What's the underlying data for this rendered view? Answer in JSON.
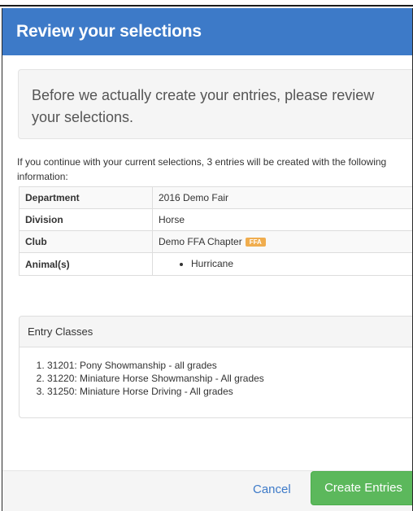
{
  "modal": {
    "title": "Review your selections",
    "lead": "Before we actually create your entries, please review your selections.",
    "info": "If you continue with your current selections, 3 entries will be created with the following information:"
  },
  "details": {
    "department_label": "Department",
    "department_value": "2016 Demo Fair",
    "division_label": "Division",
    "division_value": "Horse",
    "club_label": "Club",
    "club_value": "Demo FFA Chapter",
    "club_badge": "FFA",
    "animals_label": "Animal(s)",
    "animals": [
      "Hurricane"
    ]
  },
  "entry_classes": {
    "heading": "Entry Classes",
    "items": [
      "31201: Pony Showmanship - all grades",
      "31220: Miniature Horse Showmanship - All grades",
      "31250: Miniature Horse Driving - All grades"
    ]
  },
  "footer": {
    "cancel_label": "Cancel",
    "create_label": "Create Entries"
  },
  "colors": {
    "header": "#3d7ac8",
    "primary_button": "#5cb85c",
    "badge": "#f0ad4e",
    "link": "#3d7ac8"
  }
}
